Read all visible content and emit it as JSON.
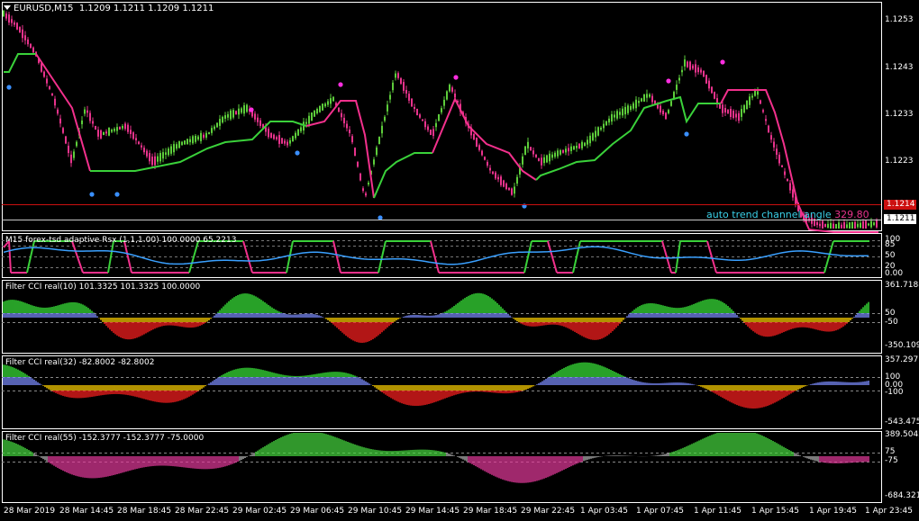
{
  "colors": {
    "bg": "#000000",
    "grid": "#3a3a3a",
    "frame": "#ffffff",
    "bull": "#5dcd3b",
    "bear": "#e8338c",
    "supertrend_up": "#3ad13a",
    "supertrend_dn": "#f2308c",
    "dot_blue": "#3a8fff",
    "dot_mag": "#ff2ee0",
    "rsx": "#3aa0ff",
    "cci_up": "#39e639",
    "cci_mid_up": "#7b8cff",
    "cci_mid_dn": "#ffd000",
    "cci_dn": "#ff2020",
    "cci55_up": "#46d83f",
    "cci55_dn": "#e3399a",
    "cci55_gray": "#b0b0b0",
    "channel_text": "#3ad0e8",
    "red_line": "#cc1010"
  },
  "header": {
    "symbol_label": "EURUSD,M15",
    "ohlc": "1.1209 1.1211 1.1209 1.1211"
  },
  "main": {
    "price_axis": [
      "1.1253",
      "1.1243",
      "1.1233",
      "1.1223"
    ],
    "bid_tag": "1.1214",
    "price_tag": "1.1211",
    "channel_label": "auto trend channel angle",
    "channel_value": "329.80"
  },
  "panes": [
    {
      "title": "M15 forex-tsd adaptive Rsx (1,1,1.00) 100.0000 65.2213",
      "axis": [
        "100",
        "85",
        "50",
        "20",
        "0.00"
      ]
    },
    {
      "title": "Filter CCI real(10)  101.3325 101.3325 100.0000",
      "axis": [
        "361.7188",
        "50",
        "-50",
        "-350.109"
      ]
    },
    {
      "title": "Filter CCI real(32)  -82.8002 -82.8002",
      "axis": [
        "357.2977",
        "100",
        "0.00",
        "-100",
        "-543.475"
      ]
    },
    {
      "title": "Filter CCI real(55)  -152.3777 -152.3777 -75.0000",
      "axis": [
        "389.5042",
        "75",
        "-75",
        "-684.321"
      ]
    }
  ],
  "time_axis": [
    "28 Mar 2019",
    "28 Mar 14:45",
    "28 Mar 18:45",
    "28 Mar 22:45",
    "29 Mar 02:45",
    "29 Mar 06:45",
    "29 Mar 10:45",
    "29 Mar 14:45",
    "29 Mar 18:45",
    "29 Mar 22:45",
    "1 Apr 03:45",
    "1 Apr 07:45",
    "1 Apr 11:45",
    "1 Apr 15:45",
    "1 Apr 19:45",
    "1 Apr 23:45"
  ]
}
